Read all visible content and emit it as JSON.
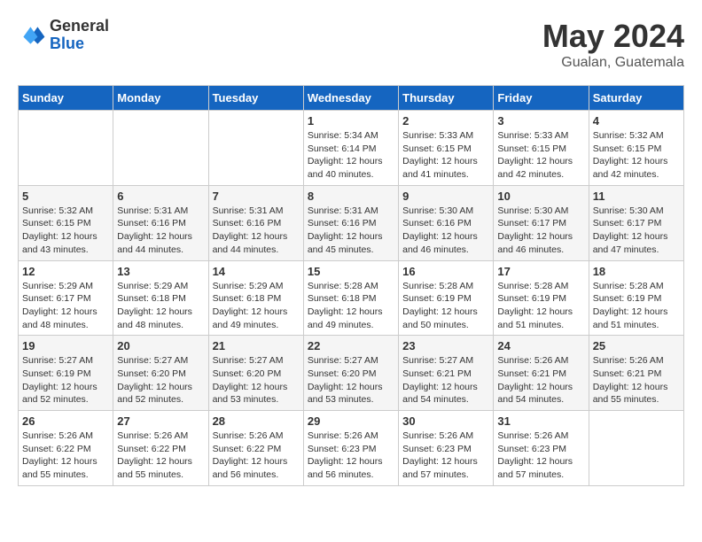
{
  "header": {
    "logo_general": "General",
    "logo_blue": "Blue",
    "month_title": "May 2024",
    "location": "Gualan, Guatemala"
  },
  "weekdays": [
    "Sunday",
    "Monday",
    "Tuesday",
    "Wednesday",
    "Thursday",
    "Friday",
    "Saturday"
  ],
  "weeks": [
    [
      {
        "day": "",
        "sunrise": "",
        "sunset": "",
        "daylight": ""
      },
      {
        "day": "",
        "sunrise": "",
        "sunset": "",
        "daylight": ""
      },
      {
        "day": "",
        "sunrise": "",
        "sunset": "",
        "daylight": ""
      },
      {
        "day": "1",
        "sunrise": "Sunrise: 5:34 AM",
        "sunset": "Sunset: 6:14 PM",
        "daylight": "Daylight: 12 hours and 40 minutes."
      },
      {
        "day": "2",
        "sunrise": "Sunrise: 5:33 AM",
        "sunset": "Sunset: 6:15 PM",
        "daylight": "Daylight: 12 hours and 41 minutes."
      },
      {
        "day": "3",
        "sunrise": "Sunrise: 5:33 AM",
        "sunset": "Sunset: 6:15 PM",
        "daylight": "Daylight: 12 hours and 42 minutes."
      },
      {
        "day": "4",
        "sunrise": "Sunrise: 5:32 AM",
        "sunset": "Sunset: 6:15 PM",
        "daylight": "Daylight: 12 hours and 42 minutes."
      }
    ],
    [
      {
        "day": "5",
        "sunrise": "Sunrise: 5:32 AM",
        "sunset": "Sunset: 6:15 PM",
        "daylight": "Daylight: 12 hours and 43 minutes."
      },
      {
        "day": "6",
        "sunrise": "Sunrise: 5:31 AM",
        "sunset": "Sunset: 6:16 PM",
        "daylight": "Daylight: 12 hours and 44 minutes."
      },
      {
        "day": "7",
        "sunrise": "Sunrise: 5:31 AM",
        "sunset": "Sunset: 6:16 PM",
        "daylight": "Daylight: 12 hours and 44 minutes."
      },
      {
        "day": "8",
        "sunrise": "Sunrise: 5:31 AM",
        "sunset": "Sunset: 6:16 PM",
        "daylight": "Daylight: 12 hours and 45 minutes."
      },
      {
        "day": "9",
        "sunrise": "Sunrise: 5:30 AM",
        "sunset": "Sunset: 6:16 PM",
        "daylight": "Daylight: 12 hours and 46 minutes."
      },
      {
        "day": "10",
        "sunrise": "Sunrise: 5:30 AM",
        "sunset": "Sunset: 6:17 PM",
        "daylight": "Daylight: 12 hours and 46 minutes."
      },
      {
        "day": "11",
        "sunrise": "Sunrise: 5:30 AM",
        "sunset": "Sunset: 6:17 PM",
        "daylight": "Daylight: 12 hours and 47 minutes."
      }
    ],
    [
      {
        "day": "12",
        "sunrise": "Sunrise: 5:29 AM",
        "sunset": "Sunset: 6:17 PM",
        "daylight": "Daylight: 12 hours and 48 minutes."
      },
      {
        "day": "13",
        "sunrise": "Sunrise: 5:29 AM",
        "sunset": "Sunset: 6:18 PM",
        "daylight": "Daylight: 12 hours and 48 minutes."
      },
      {
        "day": "14",
        "sunrise": "Sunrise: 5:29 AM",
        "sunset": "Sunset: 6:18 PM",
        "daylight": "Daylight: 12 hours and 49 minutes."
      },
      {
        "day": "15",
        "sunrise": "Sunrise: 5:28 AM",
        "sunset": "Sunset: 6:18 PM",
        "daylight": "Daylight: 12 hours and 49 minutes."
      },
      {
        "day": "16",
        "sunrise": "Sunrise: 5:28 AM",
        "sunset": "Sunset: 6:19 PM",
        "daylight": "Daylight: 12 hours and 50 minutes."
      },
      {
        "day": "17",
        "sunrise": "Sunrise: 5:28 AM",
        "sunset": "Sunset: 6:19 PM",
        "daylight": "Daylight: 12 hours and 51 minutes."
      },
      {
        "day": "18",
        "sunrise": "Sunrise: 5:28 AM",
        "sunset": "Sunset: 6:19 PM",
        "daylight": "Daylight: 12 hours and 51 minutes."
      }
    ],
    [
      {
        "day": "19",
        "sunrise": "Sunrise: 5:27 AM",
        "sunset": "Sunset: 6:19 PM",
        "daylight": "Daylight: 12 hours and 52 minutes."
      },
      {
        "day": "20",
        "sunrise": "Sunrise: 5:27 AM",
        "sunset": "Sunset: 6:20 PM",
        "daylight": "Daylight: 12 hours and 52 minutes."
      },
      {
        "day": "21",
        "sunrise": "Sunrise: 5:27 AM",
        "sunset": "Sunset: 6:20 PM",
        "daylight": "Daylight: 12 hours and 53 minutes."
      },
      {
        "day": "22",
        "sunrise": "Sunrise: 5:27 AM",
        "sunset": "Sunset: 6:20 PM",
        "daylight": "Daylight: 12 hours and 53 minutes."
      },
      {
        "day": "23",
        "sunrise": "Sunrise: 5:27 AM",
        "sunset": "Sunset: 6:21 PM",
        "daylight": "Daylight: 12 hours and 54 minutes."
      },
      {
        "day": "24",
        "sunrise": "Sunrise: 5:26 AM",
        "sunset": "Sunset: 6:21 PM",
        "daylight": "Daylight: 12 hours and 54 minutes."
      },
      {
        "day": "25",
        "sunrise": "Sunrise: 5:26 AM",
        "sunset": "Sunset: 6:21 PM",
        "daylight": "Daylight: 12 hours and 55 minutes."
      }
    ],
    [
      {
        "day": "26",
        "sunrise": "Sunrise: 5:26 AM",
        "sunset": "Sunset: 6:22 PM",
        "daylight": "Daylight: 12 hours and 55 minutes."
      },
      {
        "day": "27",
        "sunrise": "Sunrise: 5:26 AM",
        "sunset": "Sunset: 6:22 PM",
        "daylight": "Daylight: 12 hours and 55 minutes."
      },
      {
        "day": "28",
        "sunrise": "Sunrise: 5:26 AM",
        "sunset": "Sunset: 6:22 PM",
        "daylight": "Daylight: 12 hours and 56 minutes."
      },
      {
        "day": "29",
        "sunrise": "Sunrise: 5:26 AM",
        "sunset": "Sunset: 6:23 PM",
        "daylight": "Daylight: 12 hours and 56 minutes."
      },
      {
        "day": "30",
        "sunrise": "Sunrise: 5:26 AM",
        "sunset": "Sunset: 6:23 PM",
        "daylight": "Daylight: 12 hours and 57 minutes."
      },
      {
        "day": "31",
        "sunrise": "Sunrise: 5:26 AM",
        "sunset": "Sunset: 6:23 PM",
        "daylight": "Daylight: 12 hours and 57 minutes."
      },
      {
        "day": "",
        "sunrise": "",
        "sunset": "",
        "daylight": ""
      }
    ]
  ]
}
